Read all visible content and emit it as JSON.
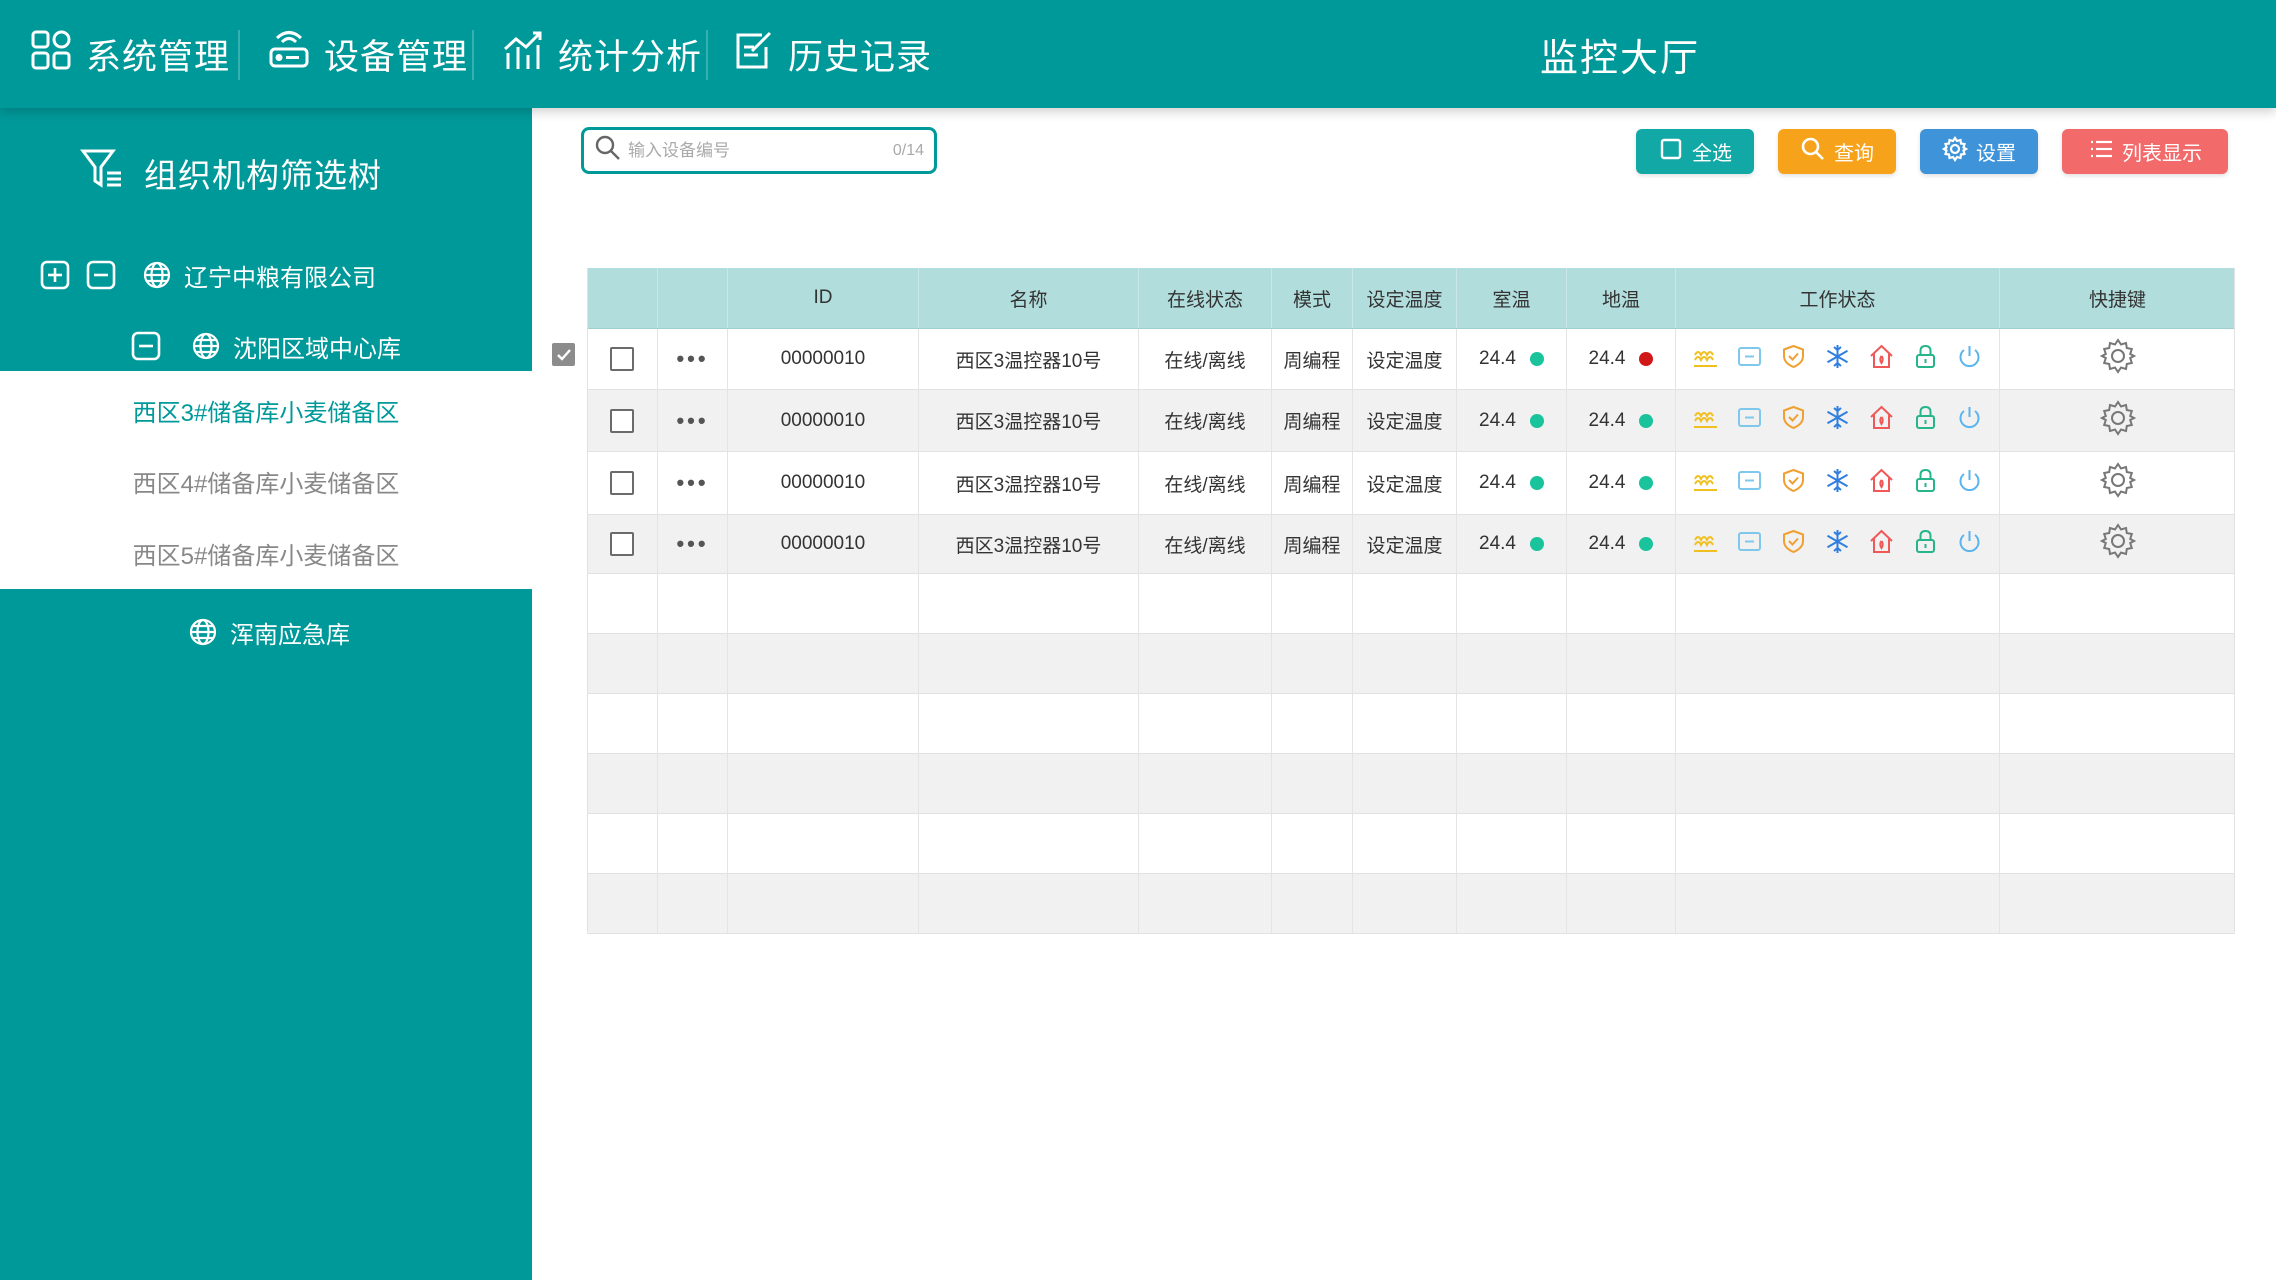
{
  "nav": {
    "items": [
      {
        "label": "系统管理",
        "icon": "grid-icon"
      },
      {
        "label": "设备管理",
        "icon": "router-icon"
      },
      {
        "label": "统计分析",
        "icon": "chart-icon"
      },
      {
        "label": "历史记录",
        "icon": "edit-note-icon"
      }
    ],
    "hall_title": "监控大厅"
  },
  "sidebar": {
    "title": "组织机构筛选树",
    "tree": {
      "root": "辽宁中粮有限公司",
      "node": "沈阳区域中心库",
      "children": [
        "西区3#储备库小麦储备区",
        "西区4#储备库小麦储备区",
        "西区5#储备库小麦储备区"
      ],
      "active_child": 0,
      "sibling": "浑南应急库"
    }
  },
  "toolbar": {
    "search_placeholder": "输入设备编号",
    "search_count": "0/14",
    "select_all": "全选",
    "query": "查询",
    "settings": "设置",
    "list_view": "列表显示"
  },
  "colors": {
    "primary": "#00999a",
    "select_all_btn": "#12a8a6",
    "query_btn": "#f7a21b",
    "settings_btn": "#3e93d9",
    "list_btn": "#f26a6a",
    "status_green": "#19c39b",
    "status_red": "#d11818",
    "header_bg": "#b1dedd"
  },
  "table": {
    "headers": [
      "",
      "",
      "ID",
      "名称",
      "在线状态",
      "模式",
      "设定温度",
      "室温",
      "地温",
      "工作状态",
      "快捷键"
    ],
    "rows": [
      {
        "id": "00000010",
        "name": "西区3温控器10号",
        "online": "在线/离线",
        "mode": "周编程",
        "set_temp": "设定温度",
        "room_temp": "24.4",
        "room_status": "green",
        "floor_temp": "24.4",
        "floor_status": "red"
      },
      {
        "id": "00000010",
        "name": "西区3温控器10号",
        "online": "在线/离线",
        "mode": "周编程",
        "set_temp": "设定温度",
        "room_temp": "24.4",
        "room_status": "green",
        "floor_temp": "24.4",
        "floor_status": "green"
      },
      {
        "id": "00000010",
        "name": "西区3温控器10号",
        "online": "在线/离线",
        "mode": "周编程",
        "set_temp": "设定温度",
        "room_temp": "24.4",
        "room_status": "green",
        "floor_temp": "24.4",
        "floor_status": "green"
      },
      {
        "id": "00000010",
        "name": "西区3温控器10号",
        "online": "在线/离线",
        "mode": "周编程",
        "set_temp": "设定温度",
        "room_temp": "24.4",
        "room_status": "green",
        "floor_temp": "24.4",
        "floor_status": "green"
      }
    ],
    "empty_rows": 6,
    "work_status_icons": [
      "floor-heat-icon",
      "panel-icon",
      "shield-icon",
      "snowflake-icon",
      "home-icon",
      "lock-icon",
      "power-icon"
    ]
  }
}
